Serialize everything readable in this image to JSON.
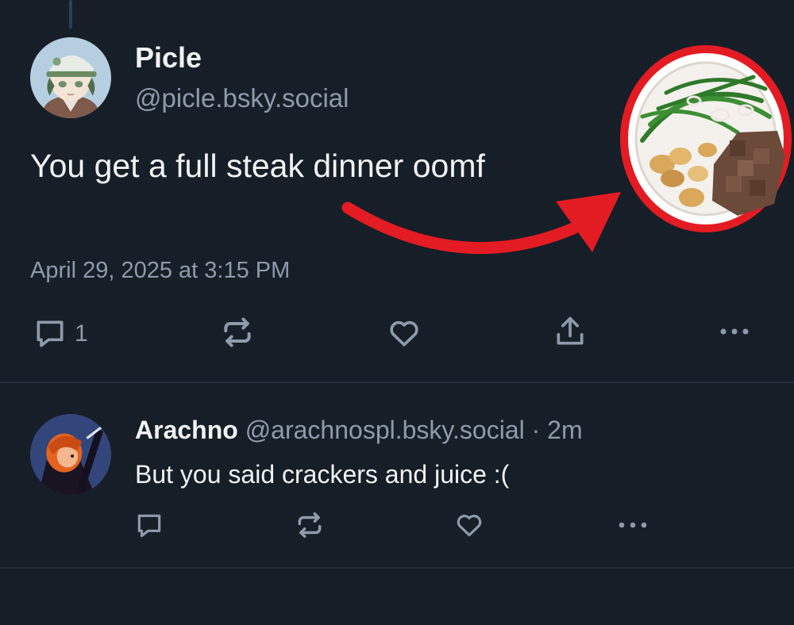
{
  "post": {
    "author_name": "Picle",
    "author_handle": "@picle.bsky.social",
    "text": "You get a full steak dinner oomf",
    "timestamp": "April 29, 2025 at 3:15 PM",
    "reply_count": "1"
  },
  "reply": {
    "author_name": "Arachno",
    "author_handle": "@arachnospl.bsky.social",
    "separator": " · ",
    "age": "2m",
    "text": "But you said crackers and juice :("
  },
  "icons": {
    "reply": "comment-icon",
    "repost": "repost-icon",
    "like": "heart-icon",
    "share": "share-icon",
    "more": "ellipsis-icon",
    "arrow": "red-arrow",
    "circle": "red-circle"
  },
  "colors": {
    "background": "#161e27",
    "text": "#f1f3f5",
    "muted": "#8e9bab",
    "divider": "#232e3a",
    "annotation_red": "#e31b23"
  }
}
